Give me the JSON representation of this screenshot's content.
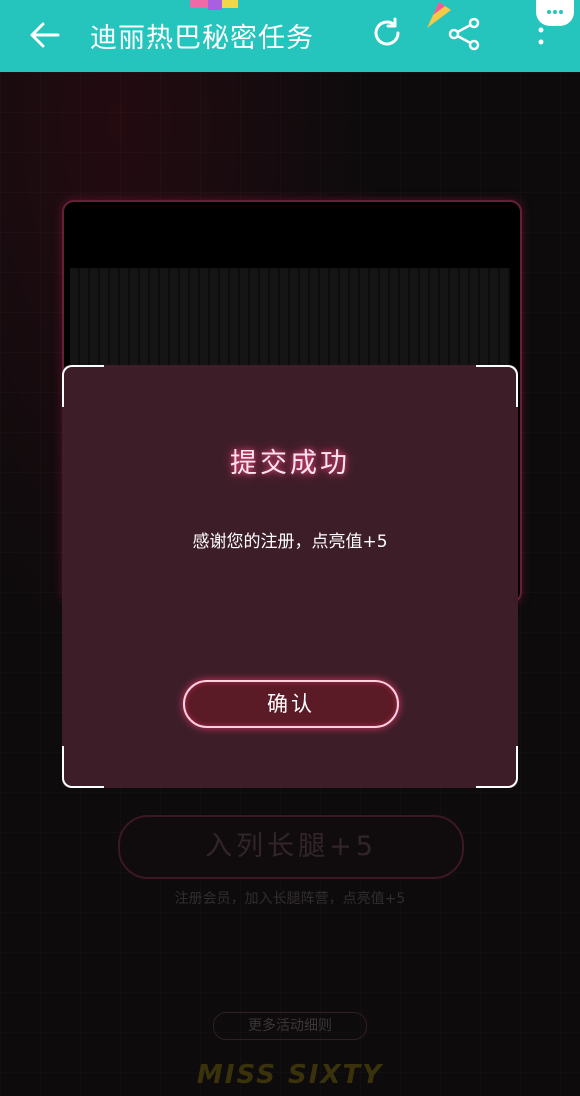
{
  "header": {
    "title": "迪丽热巴秘密任务",
    "back_icon": "back-arrow-icon",
    "refresh_icon": "refresh-icon",
    "share_icon": "share-icon",
    "more_icon": "more-vertical-icon",
    "bg_color": "#25c4bd"
  },
  "background": {
    "join_button": "入列长腿+5",
    "join_desc": "注册会员，加入长腿阵营，点亮值+5",
    "rules_link": "更多活动细则",
    "brand": "MISS SIXTY"
  },
  "modal": {
    "title": "提交成功",
    "message": "感谢您的注册，点亮值+5",
    "confirm_label": "确认",
    "accent": "#ff3c78"
  }
}
